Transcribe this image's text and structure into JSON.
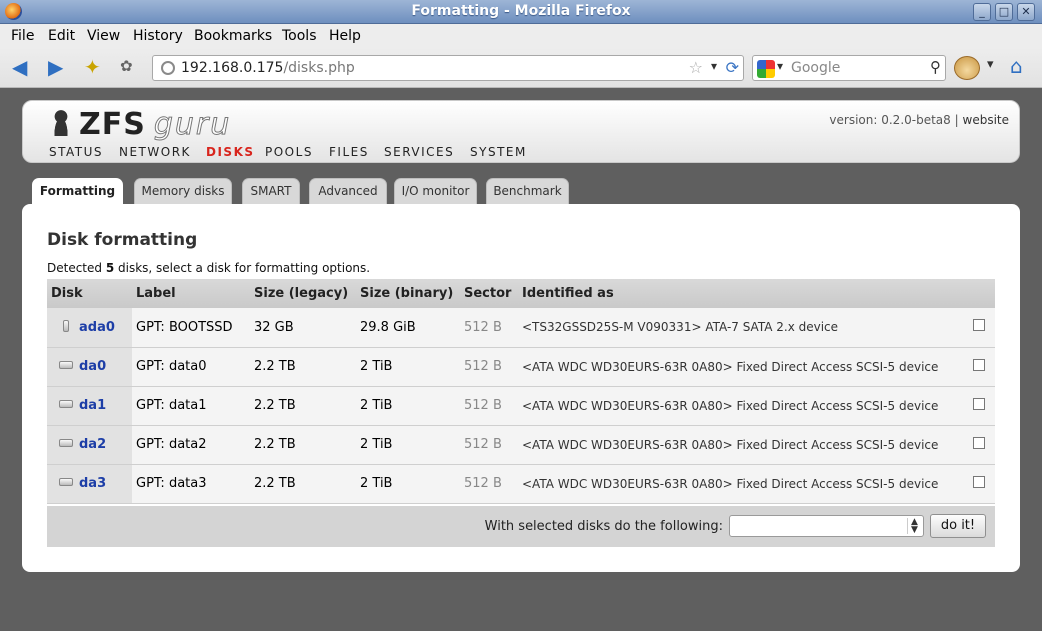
{
  "window": {
    "title": "Formatting - Mozilla Firefox"
  },
  "menu": [
    "File",
    "Edit",
    "View",
    "History",
    "Bookmarks",
    "Tools",
    "Help"
  ],
  "urlbar": {
    "host": "192.168.0.175",
    "path": "/disks.php"
  },
  "search": {
    "placeholder": "Google"
  },
  "site": {
    "logo_main": "ZFS",
    "logo_sub": "guru",
    "version_text": "version: 0.2.0-beta8",
    "version_sep": "|",
    "website_link": "website",
    "nav": [
      "STATUS",
      "NETWORK",
      "DISKS",
      "POOLS",
      "FILES",
      "SERVICES",
      "SYSTEM"
    ],
    "nav_active": "DISKS"
  },
  "tabs": [
    "Formatting",
    "Memory disks",
    "SMART",
    "Advanced",
    "I/O monitor",
    "Benchmark"
  ],
  "tab_active": "Formatting",
  "content": {
    "heading": "Disk formatting",
    "detected_pre": "Detected ",
    "detected_count": "5",
    "detected_post": " disks, select a disk for formatting options.",
    "columns": [
      "Disk",
      "Label",
      "Size (legacy)",
      "Size (binary)",
      "Sector",
      "Identified as"
    ],
    "disks": [
      {
        "name": "ada0",
        "icon": "ssd-icon",
        "label": "GPT: BOOTSSD",
        "size_legacy": "32 GB",
        "size_binary": "29.8 GiB",
        "sector": "512 B",
        "identified": "<TS32GSSD25S-M V090331> ATA-7 SATA 2.x device"
      },
      {
        "name": "da0",
        "icon": "hdd-icon",
        "label": "GPT: data0",
        "size_legacy": "2.2 TB",
        "size_binary": "2 TiB",
        "sector": "512 B",
        "identified": "<ATA WDC WD30EURS-63R 0A80> Fixed Direct Access SCSI-5 device"
      },
      {
        "name": "da1",
        "icon": "hdd-icon",
        "label": "GPT: data1",
        "size_legacy": "2.2 TB",
        "size_binary": "2 TiB",
        "sector": "512 B",
        "identified": "<ATA WDC WD30EURS-63R 0A80> Fixed Direct Access SCSI-5 device"
      },
      {
        "name": "da2",
        "icon": "hdd-icon",
        "label": "GPT: data2",
        "size_legacy": "2.2 TB",
        "size_binary": "2 TiB",
        "sector": "512 B",
        "identified": "<ATA WDC WD30EURS-63R 0A80> Fixed Direct Access SCSI-5 device"
      },
      {
        "name": "da3",
        "icon": "hdd-icon",
        "label": "GPT: data3",
        "size_legacy": "2.2 TB",
        "size_binary": "2 TiB",
        "sector": "512 B",
        "identified": "<ATA WDC WD30EURS-63R 0A80> Fixed Direct Access SCSI-5 device"
      }
    ],
    "action_label": "With selected disks do the following:",
    "action_select_value": "",
    "action_button": "do it!"
  },
  "colors": {
    "active_nav": "#d8251d",
    "disk_link": "#1d3ea7",
    "titlebar": "#7f9dc9"
  }
}
